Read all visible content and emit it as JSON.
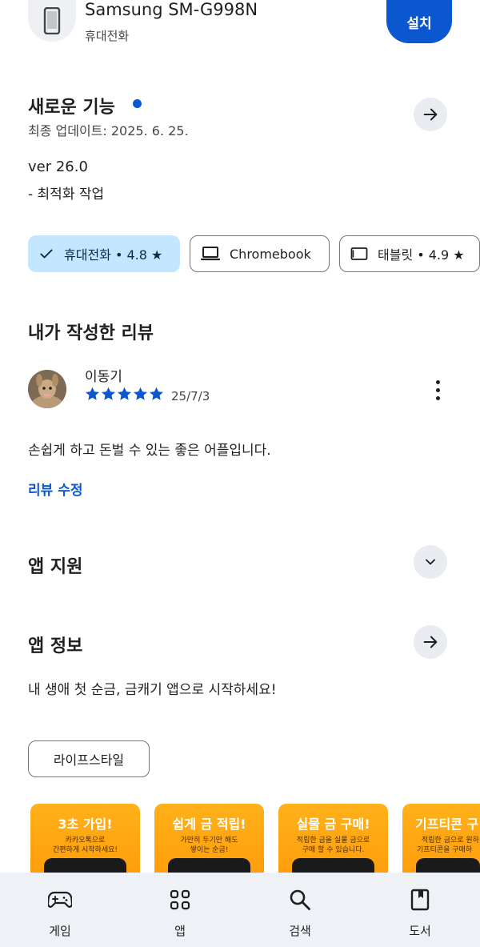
{
  "device": {
    "name": "Samsung SM-G998N",
    "type": "휴대전화",
    "install_label": "설치"
  },
  "whats_new": {
    "title": "새로운 기능",
    "updated": "최종 업데이트: 2025. 6. 25.",
    "version": "ver 26.0",
    "change": "- 최적화 작업"
  },
  "device_chips": [
    {
      "label": "휴대전화 • 4.8 ★",
      "selected": true,
      "icon": "check-icon"
    },
    {
      "label": "Chromebook",
      "selected": false,
      "icon": "laptop-icon"
    },
    {
      "label": "태블릿 • 4.9 ★",
      "selected": false,
      "icon": "tablet-icon"
    }
  ],
  "my_review": {
    "title": "내가 작성한 리뷰",
    "reviewer": "이동기",
    "rating": 5,
    "date": "25/7/3",
    "text": "손쉽게 하고 돈벌 수 있는 좋은 어플입니다.",
    "edit_label": "리뷰 수정"
  },
  "app_support": {
    "title": "앱 지원"
  },
  "app_info": {
    "title": "앱 정보",
    "description": "내 생애 첫 순금, 금캐기 앱으로 시작하세요!",
    "category": "라이프스타일"
  },
  "screenshots": [
    {
      "title": "3초 가입!",
      "sub1": "카카오톡으로",
      "sub2": "간편하게 시작하세요!"
    },
    {
      "title": "쉽게 금 적립!",
      "sub1": "가만히 두기만 해도",
      "sub2": "쌓이는 순금!"
    },
    {
      "title": "실물 금 구매!",
      "sub1": "적립한 금을 실물 금으로",
      "sub2": "구매 할 수 있습니다."
    },
    {
      "title": "기프티콘 구",
      "sub1": "적립한 금으로 원하",
      "sub2": "기프티콘을 구매하"
    }
  ],
  "bottom_nav": [
    {
      "label": "게임",
      "icon": "gamepad-icon"
    },
    {
      "label": "앱",
      "icon": "apps-grid-icon"
    },
    {
      "label": "검색",
      "icon": "search-icon"
    },
    {
      "label": "도서",
      "icon": "book-icon"
    }
  ],
  "colors": {
    "accent": "#0b57d0",
    "chip_selected_bg": "#c2e7ff",
    "nav_bg": "#eef2f7",
    "screenshot_bg": "#ffa712"
  }
}
